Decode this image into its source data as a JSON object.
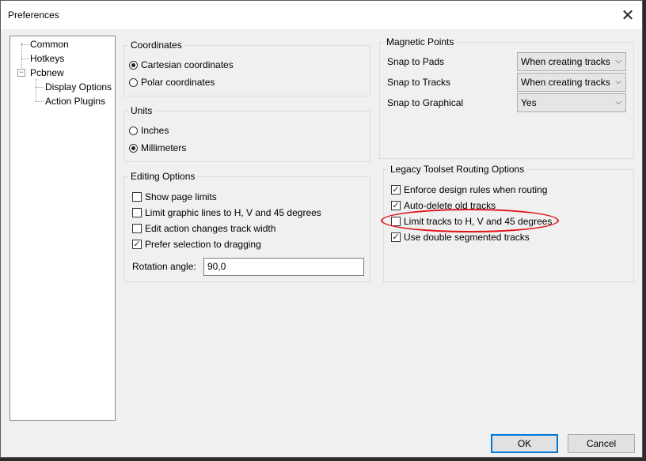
{
  "window": {
    "title": "Preferences",
    "close_glyph": "✕"
  },
  "tree": {
    "items": [
      {
        "label": "Common"
      },
      {
        "label": "Hotkeys"
      },
      {
        "label": "Pcbnew",
        "expanded": true
      },
      {
        "label": "Display Options"
      },
      {
        "label": "Action Plugins"
      }
    ]
  },
  "coordinates": {
    "title": "Coordinates",
    "options": [
      {
        "label": "Cartesian coordinates",
        "selected": true
      },
      {
        "label": "Polar coordinates",
        "selected": false
      }
    ]
  },
  "units": {
    "title": "Units",
    "options": [
      {
        "label": "Inches",
        "selected": false
      },
      {
        "label": "Millimeters",
        "selected": true
      }
    ]
  },
  "editing": {
    "title": "Editing Options",
    "checks": [
      {
        "label": "Show page limits",
        "checked": false
      },
      {
        "label": "Limit graphic lines to H, V and 45 degrees",
        "checked": false
      },
      {
        "label": "Edit action changes track width",
        "checked": false
      },
      {
        "label": "Prefer selection to dragging",
        "checked": true
      }
    ],
    "rotation_label": "Rotation angle:",
    "rotation_value": "90,0"
  },
  "magnetic": {
    "title": "Magnetic Points",
    "rows": [
      {
        "label": "Snap to Pads",
        "value": "When creating tracks"
      },
      {
        "label": "Snap to Tracks",
        "value": "When creating tracks"
      },
      {
        "label": "Snap to Graphical",
        "value": "Yes"
      }
    ]
  },
  "legacy": {
    "title": "Legacy Toolset Routing Options",
    "checks": [
      {
        "label": "Enforce design rules when routing",
        "checked": true
      },
      {
        "label": "Auto-delete old tracks",
        "checked": true
      },
      {
        "label": "Limit tracks to H, V and 45 degrees",
        "checked": false
      },
      {
        "label": "Use double segmented tracks",
        "checked": true
      }
    ]
  },
  "buttons": {
    "ok": "OK",
    "cancel": "Cancel"
  },
  "colors": {
    "annotation": "#e0161e",
    "accent": "#0078d7"
  },
  "glyphs": {
    "check": "✓",
    "chevron": "⌵",
    "expander": "−"
  }
}
